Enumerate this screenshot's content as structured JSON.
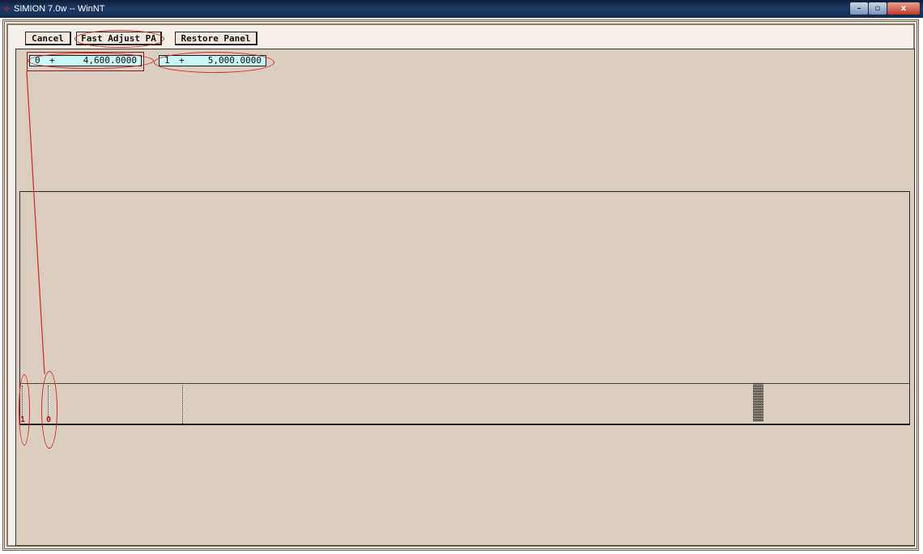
{
  "window": {
    "title": "SIMION 7.0w -- WinNT",
    "controls": {
      "minimize": "–",
      "maximize": "▫",
      "close": "x"
    }
  },
  "toolbar": {
    "cancel_label": "Cancel",
    "fast_adjust_label": "Fast Adjust PA",
    "restore_label": "Restore Panel"
  },
  "electrodes": [
    {
      "index": "0",
      "sign": "+",
      "value": "4,600.0000"
    },
    {
      "index": "1",
      "sign": "+",
      "value": "5,000.0000"
    }
  ],
  "view": {
    "tick_labels": [
      "1",
      "0"
    ]
  },
  "colors": {
    "panel_bg": "#d9cebf",
    "field_bg": "#c8f8f8",
    "annotation": "#e0241e",
    "titlebar": "#1d3b66"
  }
}
